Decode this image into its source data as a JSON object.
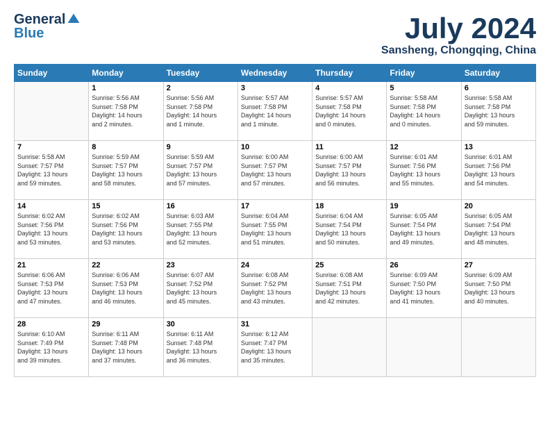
{
  "header": {
    "logo_general": "General",
    "logo_blue": "Blue",
    "title_month": "July 2024",
    "title_location": "Sansheng, Chongqing, China"
  },
  "calendar": {
    "days_of_week": [
      "Sunday",
      "Monday",
      "Tuesday",
      "Wednesday",
      "Thursday",
      "Friday",
      "Saturday"
    ],
    "weeks": [
      [
        {
          "day": "",
          "info": ""
        },
        {
          "day": "1",
          "info": "Sunrise: 5:56 AM\nSunset: 7:58 PM\nDaylight: 14 hours\nand 2 minutes."
        },
        {
          "day": "2",
          "info": "Sunrise: 5:56 AM\nSunset: 7:58 PM\nDaylight: 14 hours\nand 1 minute."
        },
        {
          "day": "3",
          "info": "Sunrise: 5:57 AM\nSunset: 7:58 PM\nDaylight: 14 hours\nand 1 minute."
        },
        {
          "day": "4",
          "info": "Sunrise: 5:57 AM\nSunset: 7:58 PM\nDaylight: 14 hours\nand 0 minutes."
        },
        {
          "day": "5",
          "info": "Sunrise: 5:58 AM\nSunset: 7:58 PM\nDaylight: 14 hours\nand 0 minutes."
        },
        {
          "day": "6",
          "info": "Sunrise: 5:58 AM\nSunset: 7:58 PM\nDaylight: 13 hours\nand 59 minutes."
        }
      ],
      [
        {
          "day": "7",
          "info": "Sunrise: 5:58 AM\nSunset: 7:57 PM\nDaylight: 13 hours\nand 59 minutes."
        },
        {
          "day": "8",
          "info": "Sunrise: 5:59 AM\nSunset: 7:57 PM\nDaylight: 13 hours\nand 58 minutes."
        },
        {
          "day": "9",
          "info": "Sunrise: 5:59 AM\nSunset: 7:57 PM\nDaylight: 13 hours\nand 57 minutes."
        },
        {
          "day": "10",
          "info": "Sunrise: 6:00 AM\nSunset: 7:57 PM\nDaylight: 13 hours\nand 57 minutes."
        },
        {
          "day": "11",
          "info": "Sunrise: 6:00 AM\nSunset: 7:57 PM\nDaylight: 13 hours\nand 56 minutes."
        },
        {
          "day": "12",
          "info": "Sunrise: 6:01 AM\nSunset: 7:56 PM\nDaylight: 13 hours\nand 55 minutes."
        },
        {
          "day": "13",
          "info": "Sunrise: 6:01 AM\nSunset: 7:56 PM\nDaylight: 13 hours\nand 54 minutes."
        }
      ],
      [
        {
          "day": "14",
          "info": "Sunrise: 6:02 AM\nSunset: 7:56 PM\nDaylight: 13 hours\nand 53 minutes."
        },
        {
          "day": "15",
          "info": "Sunrise: 6:02 AM\nSunset: 7:56 PM\nDaylight: 13 hours\nand 53 minutes."
        },
        {
          "day": "16",
          "info": "Sunrise: 6:03 AM\nSunset: 7:55 PM\nDaylight: 13 hours\nand 52 minutes."
        },
        {
          "day": "17",
          "info": "Sunrise: 6:04 AM\nSunset: 7:55 PM\nDaylight: 13 hours\nand 51 minutes."
        },
        {
          "day": "18",
          "info": "Sunrise: 6:04 AM\nSunset: 7:54 PM\nDaylight: 13 hours\nand 50 minutes."
        },
        {
          "day": "19",
          "info": "Sunrise: 6:05 AM\nSunset: 7:54 PM\nDaylight: 13 hours\nand 49 minutes."
        },
        {
          "day": "20",
          "info": "Sunrise: 6:05 AM\nSunset: 7:54 PM\nDaylight: 13 hours\nand 48 minutes."
        }
      ],
      [
        {
          "day": "21",
          "info": "Sunrise: 6:06 AM\nSunset: 7:53 PM\nDaylight: 13 hours\nand 47 minutes."
        },
        {
          "day": "22",
          "info": "Sunrise: 6:06 AM\nSunset: 7:53 PM\nDaylight: 13 hours\nand 46 minutes."
        },
        {
          "day": "23",
          "info": "Sunrise: 6:07 AM\nSunset: 7:52 PM\nDaylight: 13 hours\nand 45 minutes."
        },
        {
          "day": "24",
          "info": "Sunrise: 6:08 AM\nSunset: 7:52 PM\nDaylight: 13 hours\nand 43 minutes."
        },
        {
          "day": "25",
          "info": "Sunrise: 6:08 AM\nSunset: 7:51 PM\nDaylight: 13 hours\nand 42 minutes."
        },
        {
          "day": "26",
          "info": "Sunrise: 6:09 AM\nSunset: 7:50 PM\nDaylight: 13 hours\nand 41 minutes."
        },
        {
          "day": "27",
          "info": "Sunrise: 6:09 AM\nSunset: 7:50 PM\nDaylight: 13 hours\nand 40 minutes."
        }
      ],
      [
        {
          "day": "28",
          "info": "Sunrise: 6:10 AM\nSunset: 7:49 PM\nDaylight: 13 hours\nand 39 minutes."
        },
        {
          "day": "29",
          "info": "Sunrise: 6:11 AM\nSunset: 7:48 PM\nDaylight: 13 hours\nand 37 minutes."
        },
        {
          "day": "30",
          "info": "Sunrise: 6:11 AM\nSunset: 7:48 PM\nDaylight: 13 hours\nand 36 minutes."
        },
        {
          "day": "31",
          "info": "Sunrise: 6:12 AM\nSunset: 7:47 PM\nDaylight: 13 hours\nand 35 minutes."
        },
        {
          "day": "",
          "info": ""
        },
        {
          "day": "",
          "info": ""
        },
        {
          "day": "",
          "info": ""
        }
      ]
    ]
  }
}
